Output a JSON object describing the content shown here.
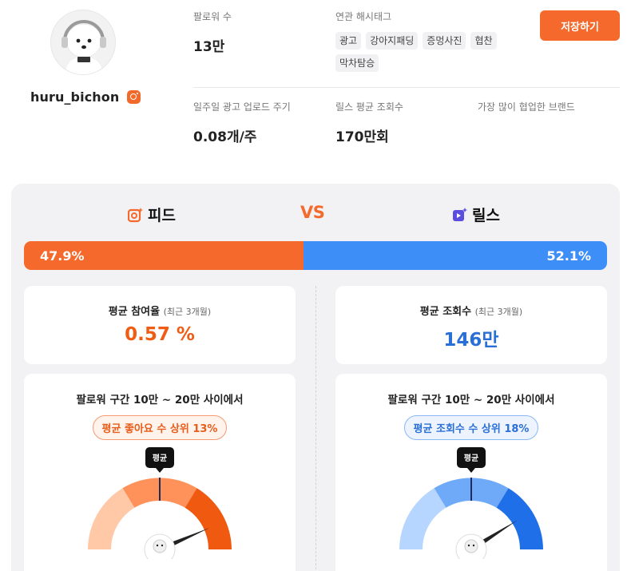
{
  "profile": {
    "username": "huru_bichon",
    "avatar_icon": "bichon-dog-photo",
    "platform_icon": "instagram-icon"
  },
  "stats": {
    "followers_label": "팔로워 수",
    "followers_value": "13만",
    "hashtags_label": "연관 해시태그",
    "hashtags": [
      "광고",
      "강아지패딩",
      "증멍사진",
      "협찬",
      "막차탐승"
    ],
    "ad_upload_label": "일주일 광고 업로드 주기",
    "ad_upload_value": "0.08개/주",
    "reels_views_label": "릴스 평균 조회수",
    "reels_views_value": "170만회",
    "brand_label": "가장 많이 협업한 브랜드"
  },
  "save_button": "저장하기",
  "compare": {
    "feed_title": "피드",
    "reels_title": "릴스",
    "vs": "VS",
    "feed_share": "47.9%",
    "reels_share": "52.1%",
    "feed_fraction": 0.479,
    "feed_color": "#f56a2c",
    "reels_color": "#3d8ef7"
  },
  "feed_card": {
    "title": "평균 참여율",
    "subtitle": "(최근 3개월)",
    "value": "0.57 %"
  },
  "reels_card": {
    "title": "평균 조회수",
    "subtitle": "(최근 3개월)",
    "value": "146만"
  },
  "feed_rank": {
    "title": "팔로워 구간 10만 ~ 20만 사이에서",
    "badge": "평균 좋아요 수 상위 13%",
    "avg_label": "평균",
    "percentile_top": 13
  },
  "reels_rank": {
    "title": "팔로워 구간 10만 ~ 20만 사이에서",
    "badge": "평균 조회수 수 상위 18%",
    "avg_label": "평균",
    "percentile_top": 18
  }
}
